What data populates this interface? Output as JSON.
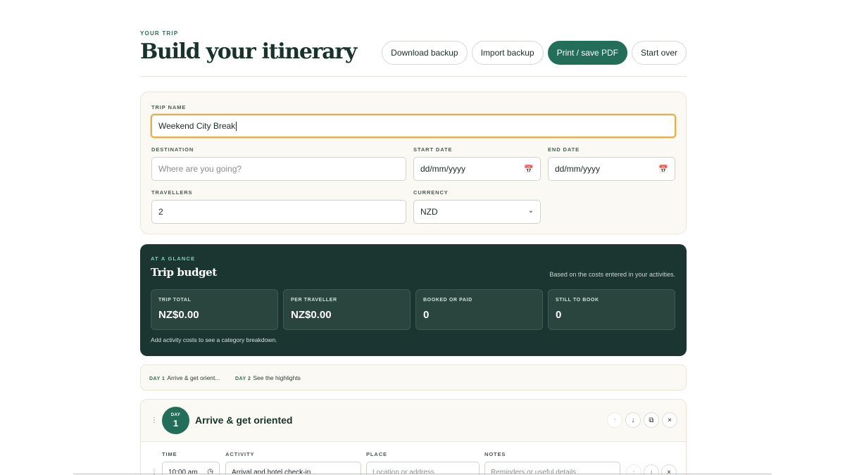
{
  "header": {
    "eyebrow": "YOUR TRIP",
    "title": "Build your itinerary",
    "actions": {
      "download": "Download backup",
      "import": "Import backup",
      "print": "Print / save PDF",
      "start_over": "Start over"
    }
  },
  "trip": {
    "name_label": "TRIP NAME",
    "name_value": "Weekend City Break",
    "destination_label": "DESTINATION",
    "destination_placeholder": "Where are you going?",
    "start_label": "START DATE",
    "start_placeholder": "dd/mm/yyyy",
    "end_label": "END DATE",
    "end_placeholder": "dd/mm/yyyy",
    "travellers_label": "TRAVELLERS",
    "travellers_value": "2",
    "currency_label": "CURRENCY",
    "currency_value": "NZD"
  },
  "budget": {
    "eyebrow": "AT A GLANCE",
    "title": "Trip budget",
    "note": "Based on the costs entered in your activities.",
    "stats": [
      {
        "label": "TRIP TOTAL",
        "value": "NZ$0.00"
      },
      {
        "label": "PER TRAVELLER",
        "value": "NZ$0.00"
      },
      {
        "label": "BOOKED OR PAID",
        "value": "0"
      },
      {
        "label": "STILL TO BOOK",
        "value": "0"
      }
    ],
    "footnote": "Add activity costs to see a category breakdown."
  },
  "day_nav": [
    {
      "tag": "DAY 1",
      "label": "Arrive & get orient..."
    },
    {
      "tag": "DAY 2",
      "label": "See the highlights"
    }
  ],
  "day": {
    "badge_small": "DAY",
    "badge_num": "1",
    "title": "Arrive & get oriented",
    "columns": {
      "time": "TIME",
      "activity": "ACTIVITY",
      "place": "PLACE",
      "notes": "NOTES"
    },
    "row": {
      "time": "10:00 am",
      "activity": "Arrival and hotel check-in",
      "place_placeholder": "Location or address",
      "notes_placeholder": "Reminders or useful details"
    }
  },
  "icons": {
    "calendar": "calendar-icon",
    "select": "chevron-down-icon",
    "clock": "clock-icon",
    "drag": "drag-handle-icon",
    "up": "arrow-up-icon",
    "down": "arrow-down-icon",
    "duplicate": "duplicate-icon",
    "remove": "close-icon"
  },
  "colors": {
    "accent": "#236e59",
    "budget_bg": "#1b3630",
    "focus": "#e0b14b"
  }
}
